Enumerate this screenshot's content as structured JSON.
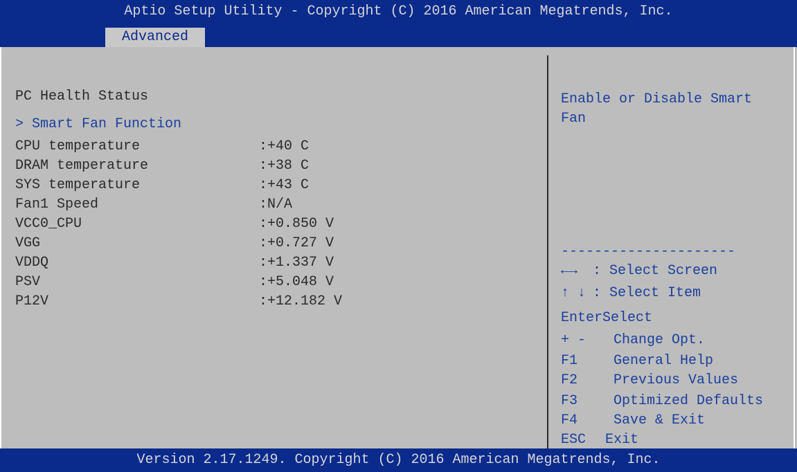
{
  "title": "Aptio Setup Utility - Copyright (C) 2016 American Megatrends, Inc.",
  "active_tab": "Advanced",
  "main": {
    "heading": "PC Health Status",
    "submenu": "> Smart Fan Function",
    "rows": [
      {
        "label": "CPU temperature",
        "value": ":+40 C"
      },
      {
        "label": "DRAM temperature",
        "value": ":+38 C"
      },
      {
        "label": "SYS temperature",
        "value": ":+43 C"
      },
      {
        "label": "Fan1 Speed",
        "value": ":N/A"
      },
      {
        "label": "VCC0_CPU",
        "value": ":+0.850 V"
      },
      {
        "label": "VGG",
        "value": ":+0.727 V"
      },
      {
        "label": "VDDQ",
        "value": ":+1.337 V"
      },
      {
        "label": "PSV",
        "value": ":+5.048 V"
      },
      {
        "label": "P12V",
        "value": ":+12.182 V"
      }
    ]
  },
  "help": {
    "line1": "Enable or Disable Smart",
    "line2": "Fan",
    "separator": "---------------------",
    "keys": [
      {
        "key": "←→",
        "desc": ": Select Screen"
      },
      {
        "key": "↑ ↓",
        "desc": ": Select Item"
      },
      {
        "key": "Enter",
        "desc": "Select"
      },
      {
        "key": "+ -",
        "desc": "Change Opt."
      },
      {
        "key": "F1",
        "desc": "General Help"
      },
      {
        "key": "F2",
        "desc": "Previous Values"
      },
      {
        "key": "F3",
        "desc": "Optimized Defaults"
      },
      {
        "key": "F4",
        "desc": "Save & Exit"
      },
      {
        "key": "ESC",
        "desc": "Exit"
      }
    ]
  },
  "footer": "Version 2.17.1249. Copyright (C) 2016 American Megatrends, Inc."
}
